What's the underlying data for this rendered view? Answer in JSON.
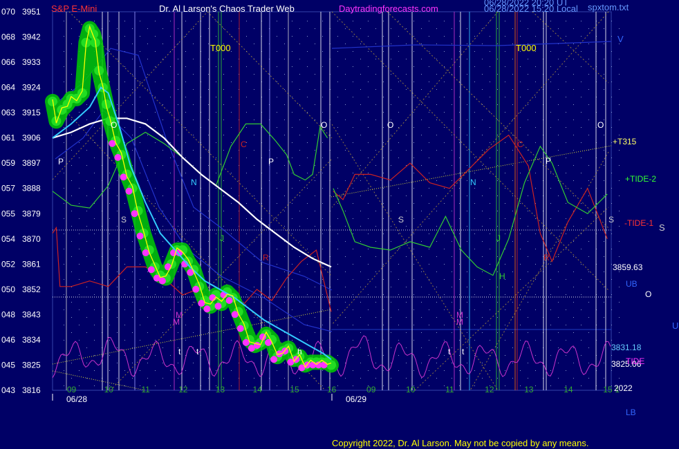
{
  "header": {
    "symbol": "S&P E-Mini",
    "title": "Dr. Al Larson's Chaos Trader Web",
    "site": "Daytradingforecasts.com",
    "timestamp_ut": "06/28/2022 20:20 UT",
    "timestamp_local": "06/28/2022 15:20 Local",
    "file": "spxtom.txt"
  },
  "footer": {
    "copyright": "Copyright 2022, Dr. Al Larson. May not be copied by any means."
  },
  "colors": {
    "background": "#000066",
    "price_bands": "#00cc00",
    "price_line": "#ffff00",
    "magenta_dots": "#ff33ff",
    "ma_fast": "#33ccff",
    "ma_slow": "#ffffff",
    "tide_red": "#cc2222",
    "tide_green": "#33cc33",
    "oscillator": "#cc33cc",
    "channel_blue": "#2233cc"
  },
  "chart_data": {
    "type": "line",
    "y_left_ticks": [
      {
        "code": "070",
        "price": 3951
      },
      {
        "code": "068",
        "price": 3942
      },
      {
        "code": "066",
        "price": 3933
      },
      {
        "code": "064",
        "price": 3924
      },
      {
        "code": "063",
        "price": 3915
      },
      {
        "code": "061",
        "price": 3906
      },
      {
        "code": "059",
        "price": 3897
      },
      {
        "code": "057",
        "price": 3888
      },
      {
        "code": "055",
        "price": 3879
      },
      {
        "code": "054",
        "price": 3870
      },
      {
        "code": "052",
        "price": 3861
      },
      {
        "code": "050",
        "price": 3852
      },
      {
        "code": "048",
        "price": 3843
      },
      {
        "code": "046",
        "price": 3834
      },
      {
        "code": "045",
        "price": 3825
      },
      {
        "code": "043",
        "price": 3816
      }
    ],
    "ylim": [
      3816,
      3951
    ],
    "x_hours_day1": [
      "09",
      "10",
      "11",
      "12",
      "13",
      "14",
      "15",
      "16"
    ],
    "x_hours_day2": [
      "09",
      "10",
      "11",
      "12",
      "13",
      "14",
      "15",
      "1"
    ],
    "x_dates": [
      "06/28",
      "06/29"
    ],
    "year_label": "2022",
    "price_series": {
      "name": "S&P E-Mini",
      "x_hours": [
        8.5,
        8.6,
        8.75,
        8.9,
        9.0,
        9.15,
        9.3,
        9.4,
        9.5,
        9.6,
        9.65,
        9.75,
        9.85,
        9.95,
        10.05,
        10.2,
        10.35,
        10.5,
        10.65,
        10.8,
        10.95,
        11.1,
        11.25,
        11.4,
        11.55,
        11.7,
        11.85,
        12.0,
        12.15,
        12.3,
        12.45,
        12.6,
        12.75,
        12.9,
        13.05,
        13.2,
        13.35,
        13.5,
        13.65,
        13.8,
        13.95,
        14.1,
        14.25,
        14.4,
        14.55,
        14.7,
        14.85,
        15.0,
        15.15,
        15.3,
        15.45,
        15.6,
        15.75,
        15.9,
        16.0
      ],
      "prices": [
        3919,
        3912,
        3916,
        3918,
        3920,
        3920,
        3922,
        3940,
        3945,
        3943,
        3940,
        3930,
        3924,
        3918,
        3912,
        3905,
        3900,
        3893,
        3888,
        3880,
        3872,
        3866,
        3860,
        3857,
        3856,
        3861,
        3866,
        3866,
        3862,
        3859,
        3853,
        3848,
        3846,
        3850,
        3847,
        3851,
        3849,
        3844,
        3839,
        3834,
        3832,
        3833,
        3836,
        3834,
        3828,
        3830,
        3831,
        3827,
        3828,
        3825,
        3826,
        3826,
        3826,
        3826,
        3825
      ]
    },
    "ma_fast": {
      "x_hours": [
        8.5,
        9.0,
        9.5,
        9.8,
        10.0,
        10.3,
        10.6,
        11.0,
        11.4,
        11.8,
        12.2,
        12.6,
        13.0,
        13.4,
        13.8,
        14.2,
        14.6,
        15.0,
        15.4,
        15.8,
        16.0
      ],
      "prices": [
        3906,
        3911,
        3917,
        3924,
        3922,
        3910,
        3896,
        3883,
        3872,
        3866,
        3860,
        3855,
        3852,
        3849,
        3845,
        3841,
        3838,
        3835,
        3832,
        3829,
        3827
      ]
    },
    "ma_slow": {
      "x_hours": [
        8.5,
        9.0,
        9.5,
        10.0,
        10.5,
        11.0,
        11.5,
        12.0,
        12.5,
        13.0,
        13.5,
        14.0,
        14.5,
        15.0,
        15.5,
        16.0
      ],
      "prices": [
        3906,
        3908,
        3911,
        3913,
        3913,
        3911,
        3906,
        3899,
        3893,
        3888,
        3883,
        3877,
        3872,
        3867,
        3863,
        3860
      ]
    },
    "tide_red_day1": {
      "x_hours": [
        8.5,
        8.6,
        8.7,
        9.0,
        9.5,
        10.0,
        10.5,
        11.0,
        11.5,
        12.0,
        12.4,
        12.8,
        13.2,
        13.6,
        14.0,
        14.4,
        14.8,
        15.2,
        15.6,
        16.0
      ],
      "prices": [
        3872,
        3874,
        3853,
        3853,
        3855,
        3853,
        3860,
        3860,
        3856,
        3850,
        3852,
        3848,
        3850,
        3846,
        3852,
        3848,
        3856,
        3862,
        3866,
        3844
      ]
    },
    "tide_green_day1": {
      "x_hours": [
        8.5,
        9.0,
        9.5,
        10.0,
        10.5,
        11.0,
        11.5,
        12.0,
        12.5,
        12.9,
        13.3,
        13.7,
        14.1,
        14.5,
        14.8,
        15.0,
        15.3,
        15.5,
        15.7,
        15.9
      ],
      "prices": [
        3887,
        3882,
        3881,
        3889,
        3904,
        3908,
        3904,
        3899,
        3893,
        3889,
        3903,
        3911,
        3911,
        3905,
        3900,
        3893,
        3891,
        3893,
        3910,
        3906
      ]
    },
    "tide_red_day2": {
      "x_hours": [
        16.05,
        16.3,
        16.6,
        17.0,
        17.5,
        18.0,
        18.5,
        19.0,
        19.5,
        20.0,
        20.5,
        21.0,
        21.3,
        21.6,
        22.0,
        22.5,
        23.0
      ],
      "prices": [
        3887,
        3884,
        3893,
        3893,
        3891,
        3897,
        3890,
        3888,
        3895,
        3902,
        3907,
        3896,
        3872,
        3862,
        3876,
        3888,
        3870
      ]
    },
    "tide_green_day2": {
      "x_hours": [
        16.05,
        16.3,
        16.6,
        17.0,
        17.5,
        18.0,
        18.5,
        18.9,
        19.3,
        19.7,
        20.1,
        20.5,
        20.9,
        21.3,
        21.6,
        22.0,
        22.5,
        23.0
      ],
      "prices": [
        3888,
        3880,
        3869,
        3867,
        3866,
        3869,
        3867,
        3878,
        3866,
        3860,
        3857,
        3870,
        3890,
        3903,
        3897,
        3883,
        3879,
        3886
      ]
    },
    "oscillator_note": "cyclic magenta oscillator along bottom",
    "level_lines": [
      {
        "label": "+T315",
        "price": 3905
      },
      {
        "label": "+TIDE-2",
        "price": 3890
      },
      {
        "label": "-TIDE-1",
        "price": 3876
      },
      {
        "label": "3859.63",
        "price": 3859.63
      },
      {
        "label": "UB",
        "price": 3851
      },
      {
        "label": "O",
        "price": 3848
      },
      {
        "label": "3831.18",
        "price": 3831.18
      },
      {
        "label": "3825.06",
        "price": 3825.06
      },
      {
        "label": "TIDE",
        "price": 3826
      },
      {
        "label": "2022",
        "price": 3816
      },
      {
        "label": "LB",
        "price": 3808
      }
    ],
    "annotations": {
      "T000_day1": "T000",
      "T000_day2": "T000",
      "V": "V",
      "S_right": "S",
      "U_right": "U",
      "letters": [
        "P",
        "O",
        "S",
        "N",
        "J",
        "M",
        "C",
        "R",
        "P",
        "O",
        "O",
        "S",
        "N",
        "J",
        "H",
        "M",
        "C",
        "R",
        "O",
        "S",
        "t",
        "t",
        "t",
        "t",
        "M",
        "M",
        "h"
      ]
    }
  }
}
